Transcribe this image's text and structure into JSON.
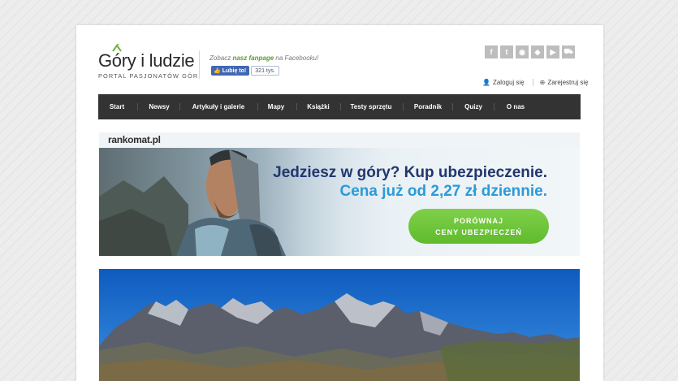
{
  "logo": {
    "title": "Góry i ludzie",
    "subtitle": "PORTAL PASJONATÓW GÓR"
  },
  "facebook": {
    "text_before": "Zobacz",
    "text_link": "nasz fanpage",
    "text_after": "na Facebooku!",
    "like_label": "Lubię to!",
    "like_count": "321 tys."
  },
  "social": [
    {
      "icon": "facebook-icon",
      "glyph": "f"
    },
    {
      "icon": "twitter-icon",
      "glyph": "t"
    },
    {
      "icon": "rss-icon",
      "glyph": "◉"
    },
    {
      "icon": "tag-icon",
      "glyph": "◆"
    },
    {
      "icon": "youtube-icon",
      "glyph": "▶"
    },
    {
      "icon": "cart-icon",
      "glyph": "⛟"
    }
  ],
  "account": {
    "login_label": "Zaloguj się",
    "register_label": "Zarejestruj się"
  },
  "nav": [
    "Start",
    "Newsy",
    "Artykuły i galerie",
    "Mapy",
    "Książki",
    "Testy sprzętu",
    "Poradnik",
    "Quizy",
    "O nas"
  ],
  "ad": {
    "brand": "rankomat.pl",
    "headline": "Jedziesz w góry? Kup ubezpieczenie.",
    "subheadline": "Cena już od 2,27 zł dziennie.",
    "cta_line1": "PORÓWNAJ",
    "cta_line2": "CENY UBEZPIECZEŃ"
  },
  "colors": {
    "nav_bg": "#333333",
    "accent_green": "#5fbb2c",
    "ad_navy": "#22376e",
    "ad_blue": "#2a9ad8",
    "facebook_blue": "#4267b2"
  }
}
